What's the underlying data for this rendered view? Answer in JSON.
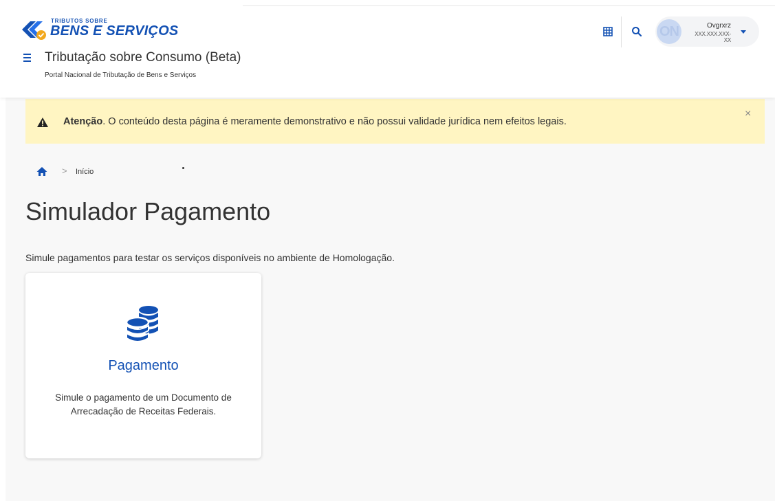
{
  "header": {
    "logo_small": "TRIBUTOS SOBRE",
    "logo_big": "BENS E SERVIÇOS",
    "app_title": "Tributação sobre Consumo (Beta)",
    "app_subtitle": "Portal Nacional de Tributação de Bens e Serviços",
    "icons": [
      "grid-icon",
      "search-icon",
      "menu-icon"
    ],
    "user": {
      "initials": "ON",
      "name": "Ovgrxrz",
      "cpf": "XXX.XXX.XXX-XX"
    }
  },
  "alert": {
    "strong": "Atenção",
    "text": ". O conteúdo desta página é meramente demonstrativo e não possui validade jurídica nem efeitos legais.",
    "close": "×"
  },
  "breadcrumb": {
    "separator": ">",
    "current": "Início"
  },
  "page": {
    "title": "Simulador Pagamento",
    "description": "Simule pagamentos para testar os serviços disponíveis no ambiente de Homologação."
  },
  "card": {
    "icon": "coins-icon",
    "title": "Pagamento",
    "description": "Simule o pagamento de um Documento de Arrecadação de Receitas Federais."
  },
  "colors": {
    "primary": "#1351b4",
    "alert_bg": "#fff5c2",
    "page_bg": "#f8f8f8",
    "logo_accent": "#f2a81d"
  }
}
